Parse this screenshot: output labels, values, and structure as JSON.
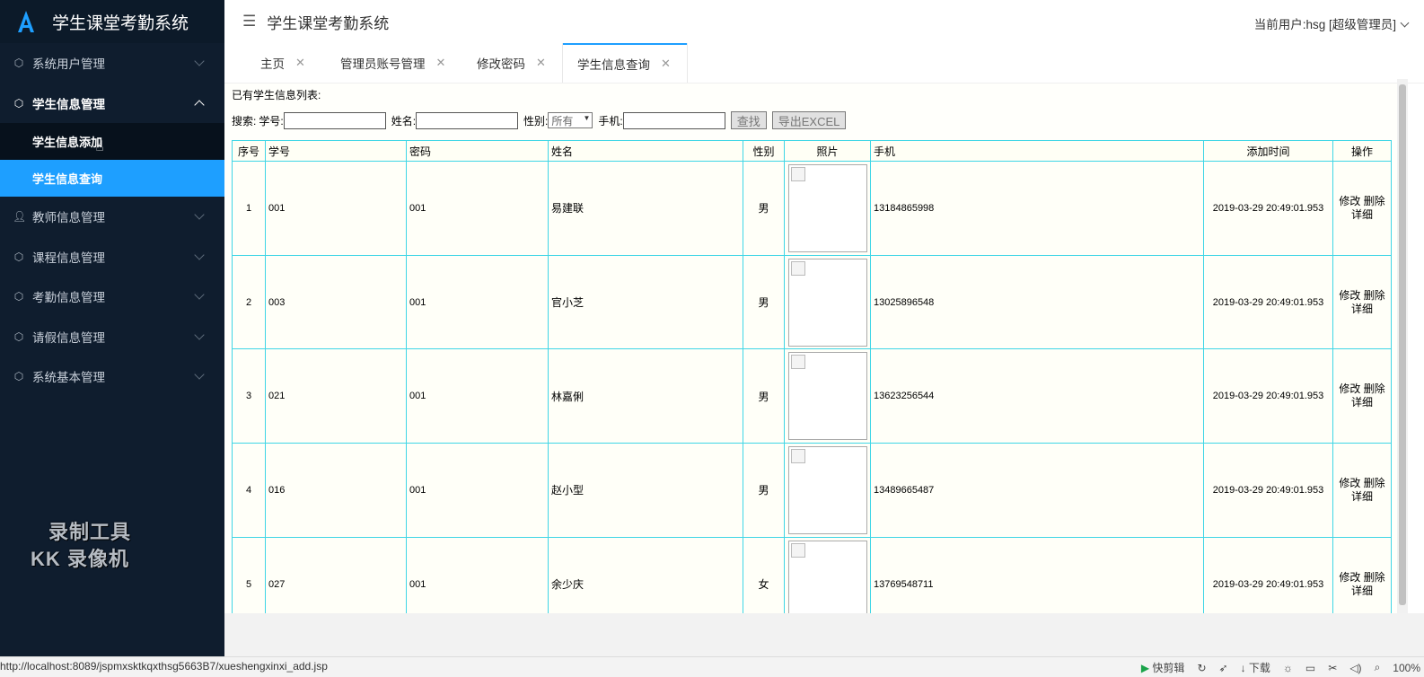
{
  "app": {
    "logo_title": "学生课堂考勤系统"
  },
  "sidebar": {
    "items": [
      {
        "label": "系统用户管理",
        "icon": "cube-icon"
      },
      {
        "label": "学生信息管理",
        "icon": "cube-icon",
        "open": true,
        "sub": [
          {
            "label": "学生信息添加"
          },
          {
            "label": "学生信息查询",
            "active": true
          }
        ]
      },
      {
        "label": "教师信息管理",
        "icon": "user-icon"
      },
      {
        "label": "课程信息管理",
        "icon": "cube-icon"
      },
      {
        "label": "考勤信息管理",
        "icon": "cube-icon"
      },
      {
        "label": "请假信息管理",
        "icon": "cube-icon"
      },
      {
        "label": "系统基本管理",
        "icon": "cube-icon"
      }
    ],
    "watermark": {
      "line1": "录制工具",
      "line2": "KK 录像机"
    }
  },
  "header": {
    "title": "学生课堂考勤系统",
    "user": "当前用户:hsg [超级管理员]"
  },
  "tabs": [
    {
      "label": "主页"
    },
    {
      "label": "管理员账号管理"
    },
    {
      "label": "修改密码"
    },
    {
      "label": "学生信息查询",
      "active": true
    }
  ],
  "content": {
    "caption": "已有学生信息列表:",
    "search": {
      "label": "搜索:",
      "xuehao_label": "学号:",
      "xingming_label": "姓名:",
      "xingbie_label": "性别:",
      "xingbie_value": "所有",
      "shouji_label": "手机:",
      "search_button": "查找",
      "export_button": "导出EXCEL"
    },
    "table": {
      "headers": [
        "序号",
        "学号",
        "密码",
        "姓名",
        "性别",
        "照片",
        "手机",
        "添加时间",
        "操作"
      ],
      "rows": [
        {
          "no": "1",
          "xuehao": "001",
          "mima": "001",
          "xingming": "易建联",
          "xingbie": "男",
          "shouji": "13184865998",
          "time": "2019-03-29 20:49:01.953"
        },
        {
          "no": "2",
          "xuehao": "003",
          "mima": "001",
          "xingming": "官小芝",
          "xingbie": "男",
          "shouji": "13025896548",
          "time": "2019-03-29 20:49:01.953"
        },
        {
          "no": "3",
          "xuehao": "021",
          "mima": "001",
          "xingming": "林嘉俐",
          "xingbie": "男",
          "shouji": "13623256544",
          "time": "2019-03-29 20:49:01.953"
        },
        {
          "no": "4",
          "xuehao": "016",
          "mima": "001",
          "xingming": "赵小型",
          "xingbie": "男",
          "shouji": "13489665487",
          "time": "2019-03-29 20:49:01.953"
        },
        {
          "no": "5",
          "xuehao": "027",
          "mima": "001",
          "xingming": "余少庆",
          "xingbie": "女",
          "shouji": "13769548711",
          "time": "2019-03-29 20:49:01.953"
        }
      ],
      "ops": {
        "edit": "修改",
        "delete": "删除",
        "detail": "详细"
      }
    }
  },
  "statusbar": {
    "url": "http://localhost:8089/jspmxsktkqxthsg5663B7/xueshengxinxi_add.jsp",
    "quick_edit": "快剪辑",
    "download": "下载",
    "zoom": "100%"
  },
  "colors": {
    "sidebar_bg": "#0f1d2e",
    "accent": "#1e9fff",
    "table_border": "#3fd6e6"
  }
}
